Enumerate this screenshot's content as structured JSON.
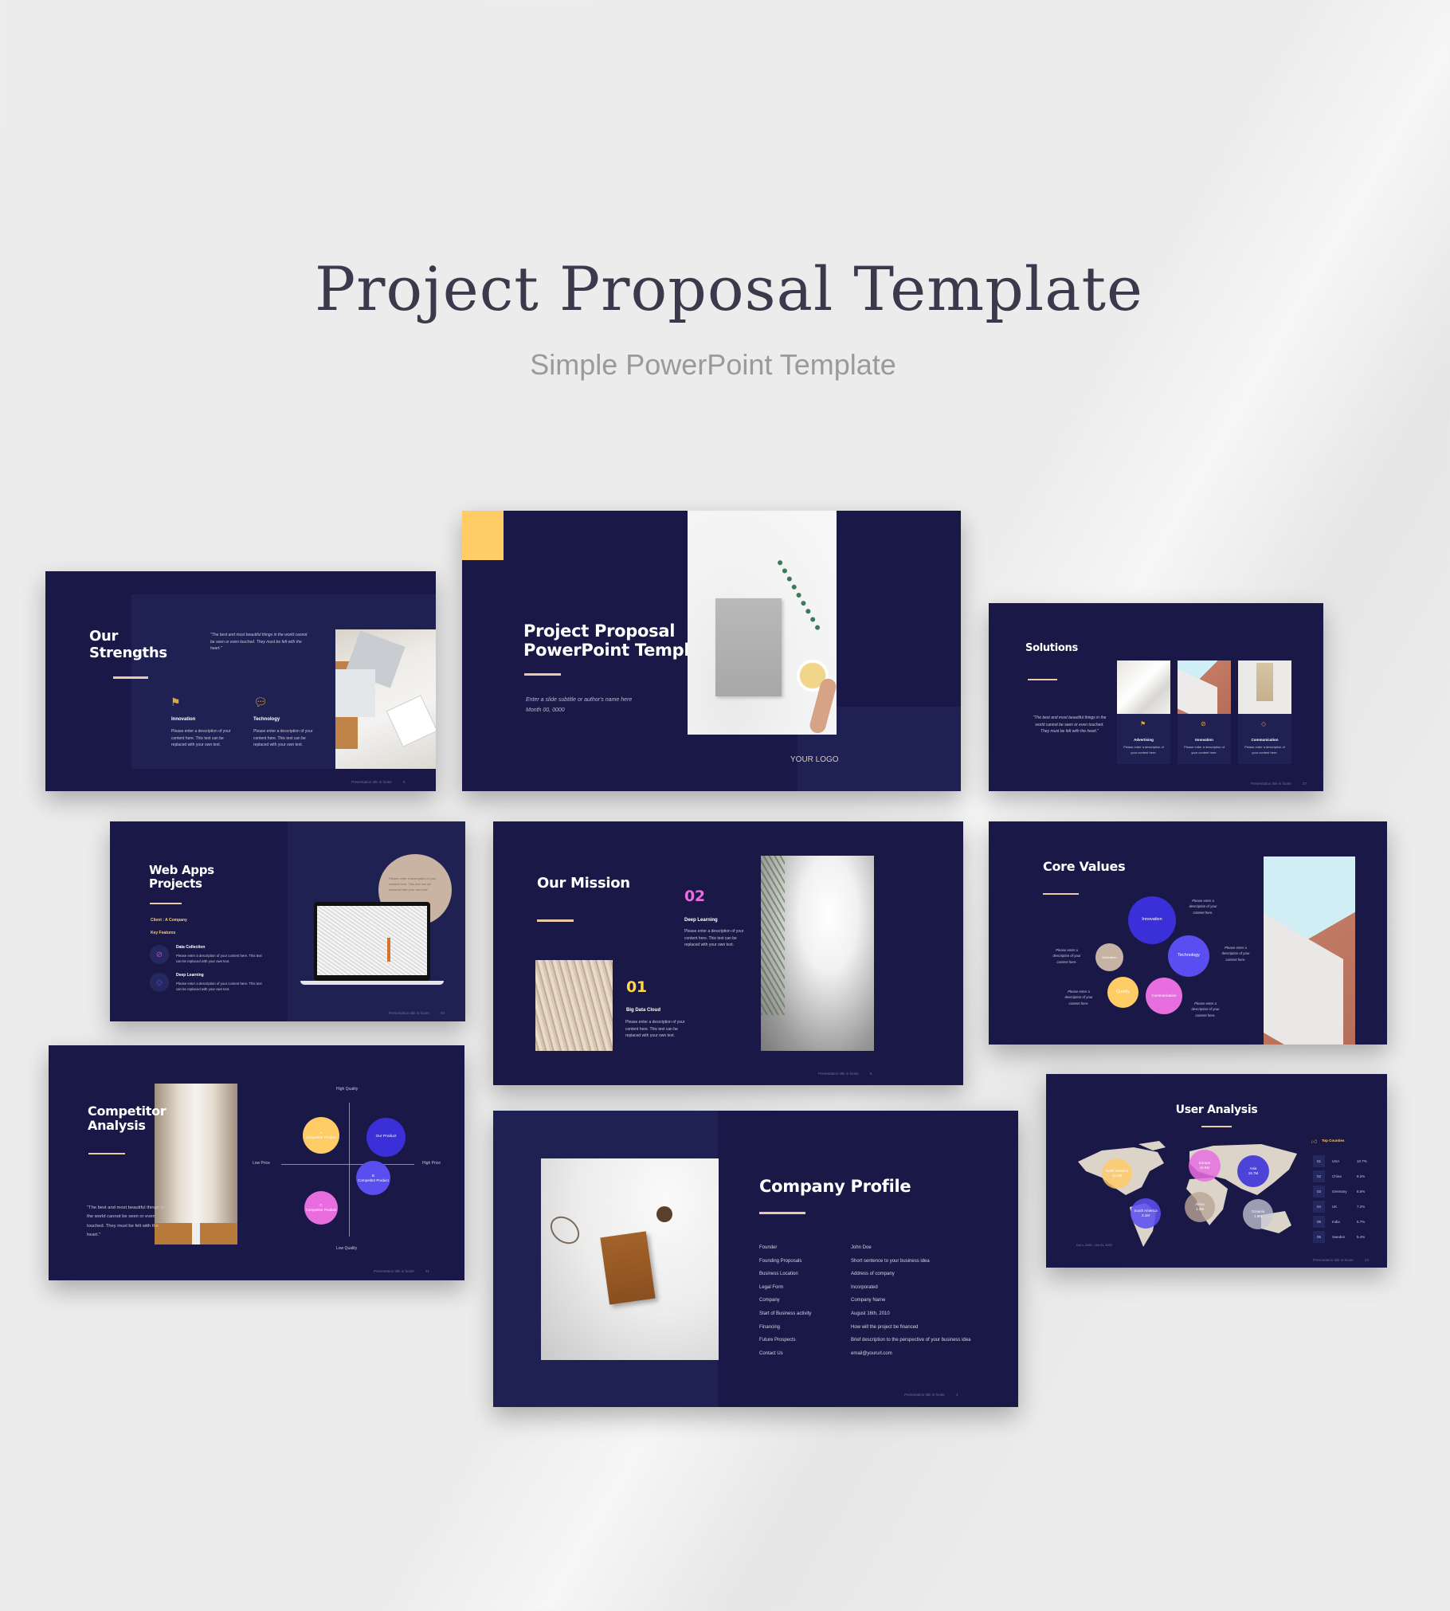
{
  "hero": {
    "title": "Project Proposal Template",
    "subtitle": "Simple PowerPoint Template"
  },
  "footer_text": "Presentation title in footer",
  "colors": {
    "navy": "#1a1847",
    "panel": "#1f2152",
    "accent_line": "#e8c9a8",
    "yellow": "#ffcc66",
    "purple": "#3a2fd8",
    "violet": "#5b4ef0",
    "pink": "#e86ee0",
    "beige": "#c7b3a3"
  },
  "strengths": {
    "title_1": "Our",
    "title_2": "Strengths",
    "quote": "\"The best and most beautiful things in the world cannot be seen or even touched. They must be felt with the heart.\"",
    "items": [
      {
        "icon": "signpost-icon",
        "label": "Innovation",
        "desc": "Please enter a description of your content here. This text can be replaced with your own text."
      },
      {
        "icon": "chat-bubbles-icon",
        "label": "Technology",
        "desc": "Please enter a description of your content here. This text can be replaced with your own text."
      }
    ],
    "page": "9"
  },
  "cover": {
    "title_1": "Project Proposal",
    "title_2": "PowerPoint Template",
    "subtitle": "Enter a slide subtitle or author's name here",
    "date": "Month 00, 0000",
    "logo": "YOUR LOGO"
  },
  "solutions": {
    "title": "Solutions",
    "quote": "\"The best and most beautiful things in the world cannot be seen or even touched. They must be felt with the heart.\"",
    "cards": [
      {
        "icon": "signpost-icon",
        "label": "Advertising",
        "desc": "Please enter a description of your content here."
      },
      {
        "icon": "compass-icon",
        "label": "Innovation",
        "desc": "Please enter a description of your content here."
      },
      {
        "icon": "tag-icon",
        "label": "Communication",
        "desc": "Please enter a description of your content here."
      }
    ],
    "page": "27"
  },
  "webapps": {
    "title_1": "Web Apps",
    "title_2": "Projects",
    "client": "Client : A Company",
    "key_features": "Key Features",
    "features": [
      {
        "icon": "compass-icon",
        "label": "Data Collection",
        "desc": "Please enter a description of your content here. This text can be replaced with your own text."
      },
      {
        "icon": "tag-icon",
        "label": "Deep Learning",
        "desc": "Please enter a description of your content here. This text can be replaced with your own text."
      }
    ],
    "bubble": "Please enter a description of your content here. This text can be replaced with your own text.",
    "page": "40"
  },
  "mission": {
    "title": "Our Mission",
    "items": [
      {
        "num": "01",
        "label": "Big Data Cloud",
        "desc": "Please enter a description of your content here. This text can be replaced with your own text."
      },
      {
        "num": "02",
        "label": "Deep Learning",
        "desc": "Please enter a description of your content here. This text can be replaced with your own text."
      }
    ],
    "page": "5"
  },
  "core": {
    "title": "Core Values",
    "desc": "Please enter a description of your content here.",
    "values": [
      "Innovation",
      "Technology",
      "Motivation",
      "Quality",
      "Communication"
    ]
  },
  "competitor": {
    "title_1": "Competitor",
    "title_2": "Analysis",
    "quote": "\"The best and most beautiful things in the world cannot be seen or even touched. They must be felt with the heart.\"",
    "axes": {
      "top": "High Quality",
      "bottom": "Low Quality",
      "left": "Low Price",
      "right": "High Price"
    },
    "products": [
      {
        "letter": "A",
        "name": "Competitor Product"
      },
      {
        "letter": "",
        "name": "Our Product"
      },
      {
        "letter": "B",
        "name": "Competitor Product"
      },
      {
        "letter": "C",
        "name": "Competitor Product"
      }
    ],
    "page": "21"
  },
  "company": {
    "title": "Company Profile",
    "rows": [
      [
        "Founder",
        "John Doe"
      ],
      [
        "Founding Proposals",
        "Short sentence to your business idea"
      ],
      [
        "Business Location",
        "Address of company"
      ],
      [
        "Legal Form",
        "Incorporated"
      ],
      [
        "Company",
        "Company Name"
      ],
      [
        "Start of Business activity",
        "August 16th, 2010"
      ],
      [
        "Financing",
        "How will the project be financed"
      ],
      [
        "Future Prospects",
        "Brief description to the perspective of your business idea"
      ],
      [
        "Contact Us",
        "email@yoururl.com"
      ]
    ],
    "page": "4"
  },
  "users": {
    "title": "User Analysis",
    "date_range": "Oct 1, 2020 - Oct 31, 2020",
    "top_header": "Top Counties",
    "regions": [
      {
        "name": "North America",
        "value": "12.4M"
      },
      {
        "name": "Europe",
        "value": "10.5M"
      },
      {
        "name": "Asia",
        "value": "16.7M"
      },
      {
        "name": "South America",
        "value": "2.1M"
      },
      {
        "name": "Africa",
        "value": "1.3M"
      },
      {
        "name": "Oceania",
        "value": "1.9M"
      }
    ],
    "countries": [
      {
        "rank": "01",
        "name": "USA",
        "pct": "10.7%"
      },
      {
        "rank": "02",
        "name": "China",
        "pct": "9.2%"
      },
      {
        "rank": "03",
        "name": "Germany",
        "pct": "8.5%"
      },
      {
        "rank": "04",
        "name": "UK",
        "pct": "7.2%"
      },
      {
        "rank": "05",
        "name": "India",
        "pct": "6.7%"
      },
      {
        "rank": "06",
        "name": "Sweden",
        "pct": "5.4%"
      }
    ],
    "page": "24"
  }
}
